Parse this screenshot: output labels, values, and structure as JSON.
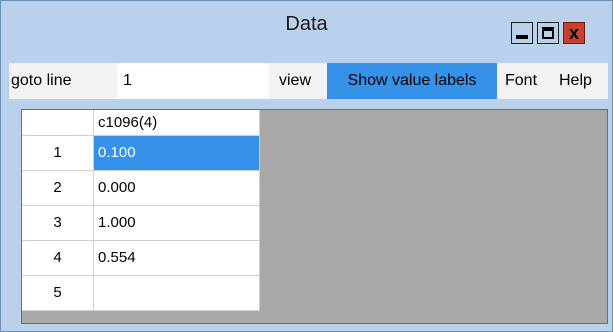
{
  "window": {
    "title": "Data",
    "controls": {
      "minimize_icon": "minimize-icon",
      "maximize_icon": "maximize-icon",
      "close_label": "x"
    }
  },
  "menubar": {
    "goto_label": "goto line",
    "goto_value": "1",
    "view_label": "view",
    "show_value_labels": "Show value labels",
    "font_label": "Font",
    "help_label": "Help"
  },
  "grid": {
    "column_header": "c1096(4)",
    "rows": [
      {
        "index": "1",
        "value": "0.100"
      },
      {
        "index": "2",
        "value": "0.000"
      },
      {
        "index": "3",
        "value": "1.000"
      },
      {
        "index": "4",
        "value": "0.554"
      },
      {
        "index": "5",
        "value": ""
      }
    ],
    "selected_row": 1
  },
  "colors": {
    "titlebar": "#b9d1ea",
    "highlight": "#3592e8",
    "close_button": "#c7412e",
    "empty_area": "#a8a8a8"
  }
}
